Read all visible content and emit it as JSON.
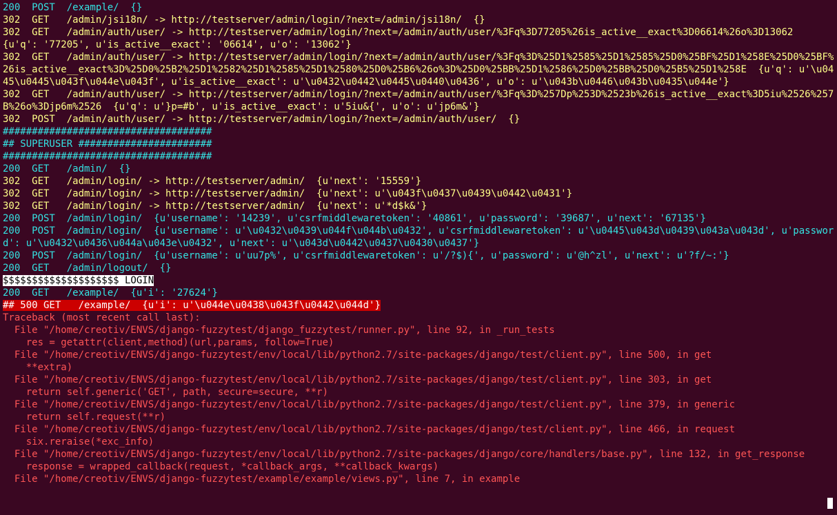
{
  "lines": [
    {
      "cls": "fg-cyan",
      "text": "200  POST  /example/  {}"
    },
    {
      "cls": "fg-yellow",
      "text": "302  GET   /admin/jsi18n/ -> http://testserver/admin/login/?next=/admin/jsi18n/  {}"
    },
    {
      "cls": "fg-yellow",
      "text": "302  GET   /admin/auth/user/ -> http://testserver/admin/login/?next=/admin/auth/user/%3Fq%3D77205%26is_active__exact%3D06614%26o%3D13062  {u'q': '77205', u'is_active__exact': '06614', u'o': '13062'}"
    },
    {
      "cls": "fg-yellow",
      "text": "302  GET   /admin/auth/user/ -> http://testserver/admin/login/?next=/admin/auth/user/%3Fq%3D%25D1%2585%25D1%2585%25D0%25BF%25D1%258E%25D0%25BF%26is_active__exact%3D%25D0%25B2%25D1%2582%25D1%2585%25D1%2580%25D0%25B6%26o%3D%25D0%25BB%25D1%2586%25D0%25BB%25D0%25B5%25D1%258E  {u'q': u'\\u0445\\u0445\\u043f\\u044e\\u043f', u'is_active__exact': u'\\u0432\\u0442\\u0445\\u0440\\u0436', u'o': u'\\u043b\\u0446\\u043b\\u0435\\u044e'}"
    },
    {
      "cls": "fg-yellow",
      "text": "302  GET   /admin/auth/user/ -> http://testserver/admin/login/?next=/admin/auth/user/%3Fq%3D%257Dp%253D%2523b%26is_active__exact%3D5iu%2526%257B%26o%3Djp6m%2526  {u'q': u'}p=#b', u'is_active__exact': u'5iu&{', u'o': u'jp6m&'}"
    },
    {
      "cls": "fg-yellow",
      "text": "302  POST  /admin/auth/user/ -> http://testserver/admin/login/?next=/admin/auth/user/  {}"
    },
    {
      "cls": "fg-cyan",
      "text": "####################################"
    },
    {
      "cls": "fg-cyan",
      "text": "## SUPERUSER #######################"
    },
    {
      "cls": "fg-cyan",
      "text": "####################################"
    },
    {
      "cls": "fg-cyan",
      "text": "200  GET   /admin/  {}"
    },
    {
      "cls": "fg-yellow",
      "text": "302  GET   /admin/login/ -> http://testserver/admin/  {u'next': '15559'}"
    },
    {
      "cls": "fg-yellow",
      "text": "302  GET   /admin/login/ -> http://testserver/admin/  {u'next': u'\\u043f\\u0437\\u0439\\u0442\\u0431'}"
    },
    {
      "cls": "fg-yellow",
      "text": "302  GET   /admin/login/ -> http://testserver/admin/  {u'next': u'*d$k&'}"
    },
    {
      "cls": "fg-cyan",
      "text": "200  POST  /admin/login/  {u'username': '14239', u'csrfmiddlewaretoken': '40861', u'password': '39687', u'next': '67135'}"
    },
    {
      "cls": "fg-cyan",
      "text": "200  POST  /admin/login/  {u'username': u'\\u0432\\u0439\\u044f\\u044b\\u0432', u'csrfmiddlewaretoken': u'\\u0445\\u043d\\u0439\\u043a\\u043d', u'password': u'\\u0432\\u0436\\u044a\\u043e\\u0432', u'next': u'\\u043d\\u0442\\u0437\\u0430\\u0437'}"
    },
    {
      "cls": "fg-cyan",
      "text": "200  POST  /admin/login/  {u'username': u'uu7p%', u'csrfmiddlewaretoken': u'/?$){', u'password': u'@h^zl', u'next': u'?f/~:'}"
    },
    {
      "cls": "fg-cyan",
      "text": "200  GET   /admin/logout/  {}"
    },
    {
      "cls": "fg-black-on-white",
      "text": "$$$$$$$$$$$$$$$$$$$$ LOGIN"
    },
    {
      "cls": "fg-cyan",
      "text": "200  GET   /example/  {u'i': '27624'}"
    },
    {
      "cls": "fg-white-on-red",
      "text": "## 500 GET   /example/  {u'i': u'\\u044e\\u0438\\u043f\\u0442\\u044d'}"
    },
    {
      "cls": "fg-red",
      "text": "Traceback (most recent call last):"
    },
    {
      "cls": "fg-red",
      "text": "  File \"/home/creotiv/ENVS/django-fuzzytest/django_fuzzytest/runner.py\", line 92, in _run_tests"
    },
    {
      "cls": "fg-red",
      "text": "    res = getattr(client,method)(url,params, follow=True)"
    },
    {
      "cls": "fg-red",
      "text": "  File \"/home/creotiv/ENVS/django-fuzzytest/env/local/lib/python2.7/site-packages/django/test/client.py\", line 500, in get"
    },
    {
      "cls": "fg-red",
      "text": "    **extra)"
    },
    {
      "cls": "fg-red",
      "text": "  File \"/home/creotiv/ENVS/django-fuzzytest/env/local/lib/python2.7/site-packages/django/test/client.py\", line 303, in get"
    },
    {
      "cls": "fg-red",
      "text": "    return self.generic('GET', path, secure=secure, **r)"
    },
    {
      "cls": "fg-red",
      "text": "  File \"/home/creotiv/ENVS/django-fuzzytest/env/local/lib/python2.7/site-packages/django/test/client.py\", line 379, in generic"
    },
    {
      "cls": "fg-red",
      "text": "    return self.request(**r)"
    },
    {
      "cls": "fg-red",
      "text": "  File \"/home/creotiv/ENVS/django-fuzzytest/env/local/lib/python2.7/site-packages/django/test/client.py\", line 466, in request"
    },
    {
      "cls": "fg-red",
      "text": "    six.reraise(*exc_info)"
    },
    {
      "cls": "fg-red",
      "text": "  File \"/home/creotiv/ENVS/django-fuzzytest/env/local/lib/python2.7/site-packages/django/core/handlers/base.py\", line 132, in get_response"
    },
    {
      "cls": "fg-red",
      "text": "    response = wrapped_callback(request, *callback_args, **callback_kwargs)"
    },
    {
      "cls": "fg-red",
      "text": "  File \"/home/creotiv/ENVS/django-fuzzytest/example/example/views.py\", line 7, in example"
    }
  ]
}
